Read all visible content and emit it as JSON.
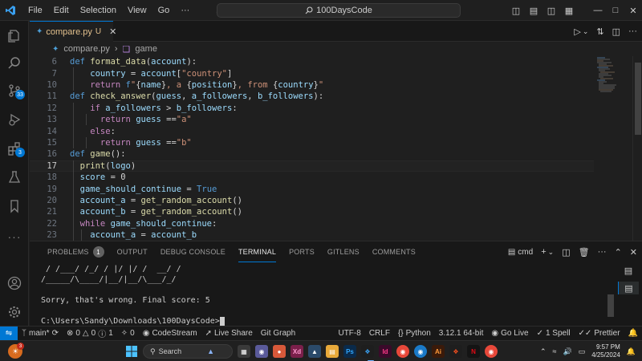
{
  "titlebar": {
    "menu": [
      "File",
      "Edit",
      "Selection",
      "View",
      "Go",
      "···"
    ],
    "search": "100DaysCode"
  },
  "activity": {
    "scm_badge": "33",
    "extensions_badge": "3"
  },
  "tab": {
    "filename": "compare.py",
    "modified_marker": "U"
  },
  "breadcrumb": {
    "file": "compare.py",
    "symbol": "game"
  },
  "editor": {
    "lines": [
      {
        "n": "6",
        "tokens": [
          [
            "kw",
            "def "
          ],
          [
            "fn",
            "format_data"
          ],
          [
            "op",
            "("
          ],
          [
            "var",
            "account"
          ],
          [
            "op",
            "):"
          ]
        ]
      },
      {
        "n": "7",
        "tokens": [
          [
            "var",
            "    country"
          ],
          [
            "op",
            " = "
          ],
          [
            "var",
            "account"
          ],
          [
            "op",
            "["
          ],
          [
            "str",
            "\"country\""
          ],
          [
            "op",
            "]"
          ]
        ]
      },
      {
        "n": "10",
        "tokens": [
          [
            "kw2",
            "    return "
          ],
          [
            "kw",
            "f"
          ],
          [
            "str",
            "\""
          ],
          [
            "op",
            "{"
          ],
          [
            "var",
            "name"
          ],
          [
            "op",
            "}"
          ],
          [
            "str",
            ", a "
          ],
          [
            "op",
            "{"
          ],
          [
            "var",
            "position"
          ],
          [
            "op",
            "}"
          ],
          [
            "str",
            ", from "
          ],
          [
            "op",
            "{"
          ],
          [
            "var",
            "country"
          ],
          [
            "op",
            "}"
          ],
          [
            "str",
            "\""
          ]
        ]
      },
      {
        "n": "11",
        "tokens": [
          [
            "kw",
            "def "
          ],
          [
            "fn",
            "check_answer"
          ],
          [
            "op",
            "("
          ],
          [
            "var",
            "guess"
          ],
          [
            "op",
            ", "
          ],
          [
            "var",
            "a_followers"
          ],
          [
            "op",
            ", "
          ],
          [
            "var",
            "b_followers"
          ],
          [
            "op",
            "):"
          ]
        ]
      },
      {
        "n": "12",
        "tokens": [
          [
            "kw2",
            "    if "
          ],
          [
            "var",
            "a_followers"
          ],
          [
            "op",
            " > "
          ],
          [
            "var",
            "b_followers"
          ],
          [
            "op",
            ":"
          ]
        ]
      },
      {
        "n": "13",
        "tokens": [
          [
            "kw2",
            "      return "
          ],
          [
            "var",
            "guess"
          ],
          [
            "op",
            " =="
          ],
          [
            "str",
            "\"a\""
          ]
        ]
      },
      {
        "n": "14",
        "tokens": [
          [
            "kw2",
            "    else"
          ],
          [
            "op",
            ":"
          ]
        ]
      },
      {
        "n": "15",
        "tokens": [
          [
            "kw2",
            "      return "
          ],
          [
            "var",
            "guess"
          ],
          [
            "op",
            " =="
          ],
          [
            "str",
            "\"b\""
          ]
        ]
      },
      {
        "n": "16",
        "tokens": [
          [
            "kw",
            "def "
          ],
          [
            "fn",
            "game"
          ],
          [
            "op",
            "():"
          ]
        ]
      },
      {
        "n": "17",
        "tokens": [
          [
            "fn",
            "  print"
          ],
          [
            "op",
            "("
          ],
          [
            "var",
            "logo"
          ],
          [
            "op",
            ")"
          ]
        ]
      },
      {
        "n": "18",
        "tokens": [
          [
            "var",
            "  score"
          ],
          [
            "op",
            " = "
          ],
          [
            "op",
            "0"
          ]
        ]
      },
      {
        "n": "19",
        "tokens": [
          [
            "var",
            "  game_should_continue"
          ],
          [
            "op",
            " = "
          ],
          [
            "bool",
            "True"
          ]
        ]
      },
      {
        "n": "20",
        "tokens": [
          [
            "var",
            "  account_a"
          ],
          [
            "op",
            " = "
          ],
          [
            "fn",
            "get_random_account"
          ],
          [
            "op",
            "()"
          ]
        ]
      },
      {
        "n": "21",
        "tokens": [
          [
            "var",
            "  account_b"
          ],
          [
            "op",
            " = "
          ],
          [
            "fn",
            "get_random_account"
          ],
          [
            "op",
            "()"
          ]
        ]
      },
      {
        "n": "22",
        "tokens": [
          [
            "kw2",
            "  while "
          ],
          [
            "var",
            "game_should_continue"
          ],
          [
            "op",
            ":"
          ]
        ]
      },
      {
        "n": "23",
        "tokens": [
          [
            "var",
            "    account_a"
          ],
          [
            "op",
            " = "
          ],
          [
            "var",
            "account_b"
          ]
        ]
      }
    ],
    "current_line": "17"
  },
  "panel": {
    "tabs": {
      "problems": "PROBLEMS",
      "problems_count": "1",
      "output": "OUTPUT",
      "debug": "DEBUG CONSOLE",
      "terminal": "TERMINAL",
      "ports": "PORTS",
      "gitlens": "GITLENS",
      "comments": "COMMENTS"
    },
    "shell": "cmd",
    "terminal_lines": [
      " / /___/ /_/ / |/ |/ /  __/ /",
      "/_____/\\____/|__/|__/\\___/_/",
      "",
      "Sorry, that's wrong. Final score: 5",
      "",
      "C:\\Users\\Sandy\\Downloads\\100DaysCode>"
    ]
  },
  "statusbar": {
    "branch": "main*",
    "errors": "0",
    "warnings": "0",
    "info": "1",
    "ports": "0",
    "codestream": "CodeStream",
    "liveshare": "Live Share",
    "gitgraph": "Git Graph",
    "encoding": "UTF-8",
    "eol": "CRLF",
    "language": "Python",
    "interpreter": "3.12.1 64-bit",
    "golive": "Go Live",
    "spell": "1 Spell",
    "prettier": "Prettier"
  },
  "taskbar": {
    "weather_badge": "3",
    "search": "Search",
    "time": "9:57 PM",
    "date": "4/25/2024"
  }
}
